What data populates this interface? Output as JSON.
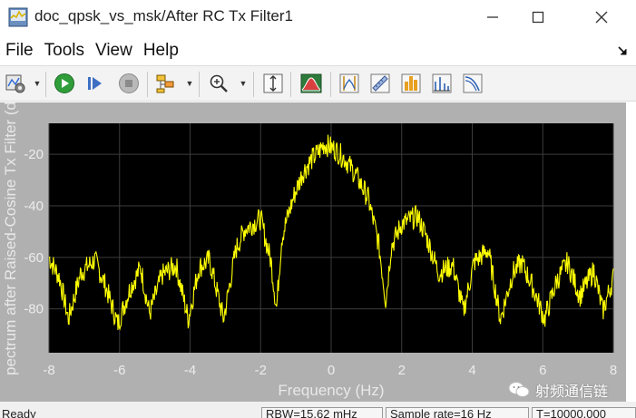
{
  "window": {
    "title": "doc_qpsk_vs_msk/After RC Tx Filter1",
    "minimize_icon": "minimize-icon",
    "maximize_icon": "maximize-icon",
    "close_icon": "close-icon"
  },
  "menu": {
    "items": [
      "File",
      "Tools",
      "View",
      "Help"
    ]
  },
  "toolbar": {
    "icons": [
      "settings-icon",
      "run-icon",
      "step-forward-icon",
      "stop-icon",
      "highlight-block-icon",
      "zoom-in-icon",
      "scale-axes-icon",
      "spectrum-settings-icon",
      "data-cursor-icon",
      "measurement-icon",
      "peak-finder-icon",
      "channel-measurement-icon",
      "distortion-measurement-icon",
      "ccdf-icon"
    ]
  },
  "colors": {
    "trace": "#ffff00",
    "axes_bg": "#000000",
    "figure_bg": "#b0b0b0",
    "grid": "#3c3c3c",
    "tick_label": "#ececec"
  },
  "chart_data": {
    "type": "line",
    "xlabel": "Frequency (Hz)",
    "ylabel": "pectrum after Raised-Cosine Tx Filter (d",
    "xlim": [
      -8,
      8
    ],
    "ylim": [
      -97,
      -8
    ],
    "x_ticks": [
      -8,
      -6,
      -4,
      -2,
      0,
      2,
      4,
      6,
      8
    ],
    "y_ticks": [
      -20,
      -40,
      -60,
      -80
    ],
    "x_tick_labels": [
      "-8",
      "-6",
      "-4",
      "-2",
      "0",
      "2",
      "4",
      "6",
      "8"
    ],
    "y_tick_labels": [
      "-20",
      "-40",
      "-60",
      "-80"
    ],
    "grid": true,
    "series": [
      {
        "x": [
          -8,
          -7.7,
          -7.45,
          -7.1,
          -6.7,
          -6.4,
          -6.05,
          -5.7,
          -5.4,
          -5.15,
          -4.8,
          -4.4,
          -4.05,
          -3.75,
          -3.45,
          -3.05,
          -2.7,
          -2.45,
          -2.0,
          -1.7,
          -1.55,
          -1.4,
          -1.05,
          -0.8,
          -0.55,
          -0.35,
          -0.2,
          0.1,
          0.4,
          0.7,
          1.05,
          1.35,
          1.55,
          1.7,
          2.0,
          2.45,
          2.7,
          3.05,
          3.45,
          3.75,
          4.05,
          4.45,
          4.8,
          5.15,
          5.4,
          5.7,
          6.05,
          6.4,
          6.7,
          7.05,
          7.45,
          7.7,
          8.0
        ],
        "y": [
          -60,
          -68,
          -84,
          -66,
          -61,
          -71,
          -86,
          -72,
          -64,
          -82,
          -67,
          -63,
          -84,
          -64,
          -61,
          -84,
          -57,
          -49,
          -45,
          -62,
          -80,
          -52,
          -36,
          -27,
          -22,
          -19,
          -16,
          -18,
          -22,
          -28,
          -37,
          -55,
          -77,
          -56,
          -47,
          -44,
          -52,
          -66,
          -63,
          -81,
          -62,
          -57,
          -84,
          -66,
          -62,
          -71,
          -84,
          -69,
          -62,
          -75,
          -65,
          -81,
          -68
        ]
      }
    ]
  },
  "status": {
    "left_text": "Ready",
    "rbw": "RBW=15.62 mHz",
    "sample_rate": "Sample rate=16 Hz",
    "time": "T=10000.000"
  },
  "watermark": {
    "text": "射频通信链",
    "logo_icon": "wechat-logo-icon"
  }
}
